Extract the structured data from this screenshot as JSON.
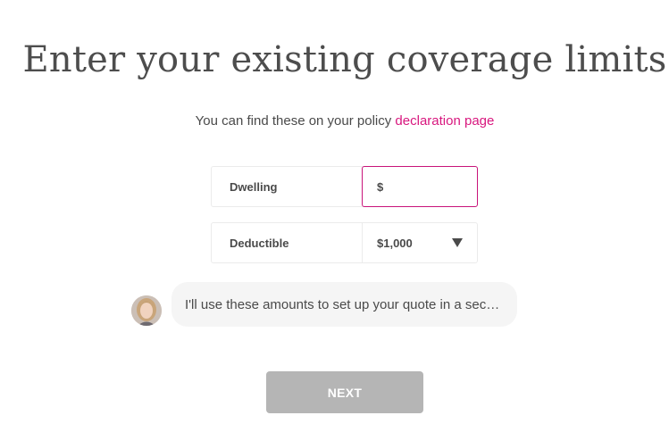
{
  "page": {
    "title": "Enter your existing coverage limits",
    "subtitle_text": "You can find these on your policy ",
    "subtitle_link": "declaration page"
  },
  "form": {
    "dwelling": {
      "label": "Dwelling",
      "prefix": "$",
      "value": ""
    },
    "deductible": {
      "label": "Deductible",
      "selected": "$1,000"
    }
  },
  "chat": {
    "message": "I'll use these amounts to set up your quote in a sec…"
  },
  "actions": {
    "next_label": "NEXT"
  },
  "colors": {
    "accent": "#d8177e",
    "button_disabled": "#b5b5b5",
    "bubble_bg": "#f5f5f5"
  }
}
